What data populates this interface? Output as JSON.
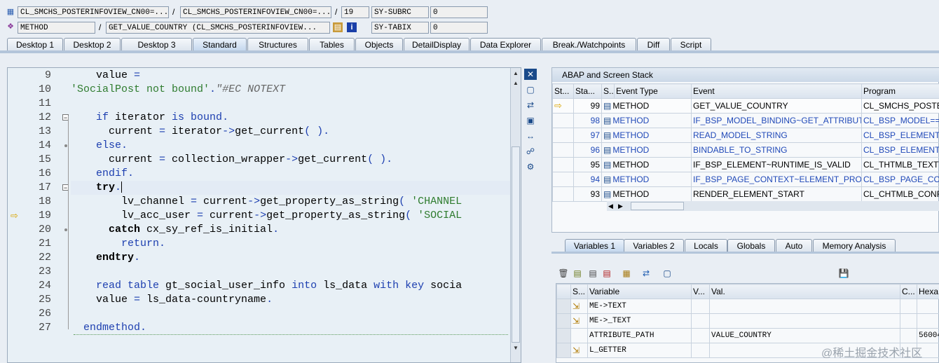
{
  "header": {
    "row1": {
      "field1": "CL_SMCHS_POSTERINFOVIEW_CN00=...",
      "sep1": "/",
      "field2": "CL_SMCHS_POSTERINFOVIEW_CN00=...",
      "sep2": "/",
      "line": "19",
      "sysvar": "SY-SUBRC",
      "sysval": "0"
    },
    "row2": {
      "field1": "METHOD",
      "sep1": "/",
      "field2": "GET_VALUE_COUNTRY (CL_SMCHS_POSTERINFOVIEW...",
      "info_icon": "i",
      "sysvar": "SY-TABIX",
      "sysval": "0"
    }
  },
  "tabs": [
    "Desktop 1",
    "Desktop 2",
    "Desktop 3",
    "Standard",
    "Structures",
    "Tables",
    "Objects",
    "DetailDisplay",
    "Data Explorer",
    "Break./Watchpoints",
    "Diff",
    "Script"
  ],
  "active_tab": "Standard",
  "code": {
    "lines": [
      {
        "n": "9",
        "segs": [
          {
            "t": "    value ",
            "c": ""
          },
          {
            "t": "=",
            "c": "kw"
          }
        ]
      },
      {
        "n": "10",
        "segs": [
          {
            "t": "'SocialPost not bound'",
            "c": "str"
          },
          {
            "t": ".",
            "c": "kw"
          },
          {
            "t": "\"#EC NOTEXT",
            "c": "cmt"
          }
        ]
      },
      {
        "n": "11",
        "segs": []
      },
      {
        "n": "12",
        "segs": [
          {
            "t": "    ",
            "c": ""
          },
          {
            "t": "if",
            "c": "kw"
          },
          {
            "t": " iterator ",
            "c": ""
          },
          {
            "t": "is bound",
            "c": "kw"
          },
          {
            "t": ".",
            "c": "kw"
          }
        ]
      },
      {
        "n": "13",
        "segs": [
          {
            "t": "      current ",
            "c": ""
          },
          {
            "t": "=",
            "c": "kw"
          },
          {
            "t": " iterator",
            "c": ""
          },
          {
            "t": "->",
            "c": "kw"
          },
          {
            "t": "get_current",
            "c": ""
          },
          {
            "t": "( ).",
            "c": "kw"
          }
        ]
      },
      {
        "n": "14",
        "segs": [
          {
            "t": "    ",
            "c": ""
          },
          {
            "t": "else",
            "c": "kw"
          },
          {
            "t": ".",
            "c": "kw"
          }
        ]
      },
      {
        "n": "15",
        "segs": [
          {
            "t": "      current ",
            "c": ""
          },
          {
            "t": "=",
            "c": "kw"
          },
          {
            "t": " collection_wrapper",
            "c": ""
          },
          {
            "t": "->",
            "c": "kw"
          },
          {
            "t": "get_current",
            "c": ""
          },
          {
            "t": "( ).",
            "c": "kw"
          }
        ]
      },
      {
        "n": "16",
        "segs": [
          {
            "t": "    ",
            "c": ""
          },
          {
            "t": "endif",
            "c": "kw"
          },
          {
            "t": ".",
            "c": "kw"
          }
        ]
      },
      {
        "n": "17",
        "segs": [
          {
            "t": "    ",
            "c": ""
          },
          {
            "t": "try",
            "c": "kwb"
          },
          {
            "t": ".",
            "c": "kw"
          }
        ]
      },
      {
        "n": "18",
        "segs": [
          {
            "t": "        lv_channel ",
            "c": ""
          },
          {
            "t": "=",
            "c": "kw"
          },
          {
            "t": " current",
            "c": ""
          },
          {
            "t": "->",
            "c": "kw"
          },
          {
            "t": "get_property_as_string",
            "c": ""
          },
          {
            "t": "( ",
            "c": "kw"
          },
          {
            "t": "'CHANNEL",
            "c": "str"
          }
        ]
      },
      {
        "n": "19",
        "segs": [
          {
            "t": "        lv_acc_user ",
            "c": ""
          },
          {
            "t": "=",
            "c": "kw"
          },
          {
            "t": " current",
            "c": ""
          },
          {
            "t": "->",
            "c": "kw"
          },
          {
            "t": "get_property_as_string",
            "c": ""
          },
          {
            "t": "( ",
            "c": "kw"
          },
          {
            "t": "'SOCIAL",
            "c": "str"
          }
        ]
      },
      {
        "n": "20",
        "segs": [
          {
            "t": "      ",
            "c": ""
          },
          {
            "t": "catch",
            "c": "kwb"
          },
          {
            "t": " cx_sy_ref_is_initial",
            "c": ""
          },
          {
            "t": ".",
            "c": "kw"
          }
        ]
      },
      {
        "n": "21",
        "segs": [
          {
            "t": "        ",
            "c": ""
          },
          {
            "t": "return",
            "c": "kw"
          },
          {
            "t": ".",
            "c": "kw"
          }
        ]
      },
      {
        "n": "22",
        "segs": [
          {
            "t": "    ",
            "c": ""
          },
          {
            "t": "endtry",
            "c": "kwb"
          },
          {
            "t": ".",
            "c": "kw"
          }
        ]
      },
      {
        "n": "23",
        "segs": []
      },
      {
        "n": "24",
        "segs": [
          {
            "t": "    ",
            "c": ""
          },
          {
            "t": "read table",
            "c": "kw"
          },
          {
            "t": " gt_social_user_info ",
            "c": ""
          },
          {
            "t": "into",
            "c": "kw"
          },
          {
            "t": " ls_data ",
            "c": ""
          },
          {
            "t": "with key",
            "c": "kw"
          },
          {
            "t": " socia",
            "c": ""
          }
        ]
      },
      {
        "n": "25",
        "segs": [
          {
            "t": "    value ",
            "c": ""
          },
          {
            "t": "=",
            "c": "kw"
          },
          {
            "t": " ls_data-countryname",
            "c": ""
          },
          {
            "t": ".",
            "c": "kw"
          }
        ]
      },
      {
        "n": "26",
        "segs": []
      },
      {
        "n": "27",
        "segs": [
          {
            "t": "  ",
            "c": ""
          },
          {
            "t": "endmethod",
            "c": "kw"
          },
          {
            "t": ".",
            "c": "kw"
          }
        ]
      }
    ]
  },
  "stack": {
    "title": "ABAP and Screen Stack",
    "columns": [
      "St...",
      "Sta...",
      "S...",
      "Event Type",
      "Event",
      "Program"
    ],
    "rows": [
      {
        "level": "99",
        "type": "METHOD",
        "event": "GET_VALUE_COUNTRY",
        "program": "CL_SMCHS_POSTER",
        "current": true,
        "link": false
      },
      {
        "level": "98",
        "type": "METHOD",
        "event": "IF_BSP_MODEL_BINDING~GET_ATTRIBUTE",
        "program": "CL_BSP_MODEL===",
        "current": false,
        "link": true
      },
      {
        "level": "97",
        "type": "METHOD",
        "event": "READ_MODEL_STRING",
        "program": "CL_BSP_ELEMENT_",
        "current": false,
        "link": true
      },
      {
        "level": "96",
        "type": "METHOD",
        "event": "BINDABLE_TO_STRING",
        "program": "CL_BSP_ELEMENT_",
        "current": false,
        "link": true
      },
      {
        "level": "95",
        "type": "METHOD",
        "event": "IF_BSP_ELEMENT~RUNTIME_IS_VALID",
        "program": "CL_THTMLB_TEXTV",
        "current": false,
        "link": false
      },
      {
        "level": "94",
        "type": "METHOD",
        "event": "IF_BSP_PAGE_CONTEXT~ELEMENT_PROC...",
        "program": "CL_BSP_PAGE_CON",
        "current": false,
        "link": true
      },
      {
        "level": "93",
        "type": "METHOD",
        "event": "RENDER_ELEMENT_START",
        "program": "CL_CHTMLB_CONFI",
        "current": false,
        "link": false
      }
    ]
  },
  "var_tabs": [
    "Variables 1",
    "Variables 2",
    "Locals",
    "Globals",
    "Auto",
    "Memory Analysis"
  ],
  "active_var_tab": "Variables 1",
  "variables": {
    "columns": [
      "S...",
      "Variable",
      "V...",
      "Val.",
      "C...",
      "Hexa"
    ],
    "rows": [
      {
        "name": "ME->TEXT",
        "value": "",
        "hex": "",
        "icon": true
      },
      {
        "name": "ME->_TEXT",
        "value": "",
        "hex": "",
        "icon": true
      },
      {
        "name": "ATTRIBUTE_PATH",
        "value": "VALUE_COUNTRY",
        "hex": "56004",
        "icon": false
      },
      {
        "name": "L_GETTER",
        "value": "",
        "hex": "",
        "icon": true
      }
    ]
  },
  "watermark": "@稀土掘金技术社区"
}
